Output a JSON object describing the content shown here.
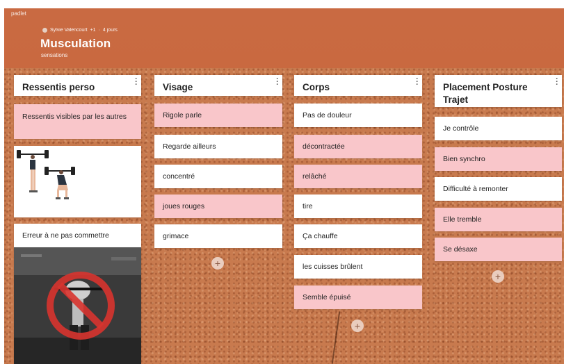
{
  "app": {
    "name": "padlet"
  },
  "header": {
    "author": "Sylvie Valencourt",
    "meta_plus": "+1",
    "meta_time": "4 jours",
    "title": "Musculation",
    "subtitle": "sensations"
  },
  "columns": [
    {
      "title": "Ressentis perso",
      "cards": [
        {
          "text": "Ressentis visibles par les autres",
          "color": "#f9c6ca"
        },
        {
          "text": "Erreur à ne pas commettre",
          "color": "#ffffff"
        }
      ]
    },
    {
      "title": "Visage",
      "cards": [
        {
          "text": "Rigole parle",
          "color": "#f9c6ca"
        },
        {
          "text": "Regarde ailleurs",
          "color": "#ffffff"
        },
        {
          "text": "concentré",
          "color": "#ffffff"
        },
        {
          "text": "joues rouges",
          "color": "#f9c6ca"
        },
        {
          "text": "grimace",
          "color": "#ffffff"
        }
      ]
    },
    {
      "title": "Corps",
      "cards": [
        {
          "text": "Pas de douleur",
          "color": "#ffffff"
        },
        {
          "text": "décontractée",
          "color": "#f9c6ca"
        },
        {
          "text": "relâché",
          "color": "#f9c6ca"
        },
        {
          "text": "tire",
          "color": "#ffffff"
        },
        {
          "text": "Ça chauffe",
          "color": "#ffffff"
        },
        {
          "text": "les cuisses brûlent",
          "color": "#ffffff"
        },
        {
          "text": "Semble épuisé",
          "color": "#f9c6ca"
        }
      ]
    },
    {
      "title": "Placement Posture Trajet",
      "cards": [
        {
          "text": "Je contrôle",
          "color": "#ffffff"
        },
        {
          "text": "Bien synchro",
          "color": "#f9c6ca"
        },
        {
          "text": "Difficulté à remonter",
          "color": "#ffffff"
        },
        {
          "text": "Elle tremble",
          "color": "#f9c6ca"
        },
        {
          "text": "Se désaxe",
          "color": "#f9c6ca"
        }
      ]
    }
  ],
  "add_label": "+",
  "colors": {
    "header_bg": "#c96a42",
    "card_pink": "#f9c6ca",
    "card_white": "#ffffff"
  },
  "icons": {
    "column_menu": "kebab-menu-icon",
    "add": "plus-icon",
    "forbidden": "prohibition-icon"
  }
}
